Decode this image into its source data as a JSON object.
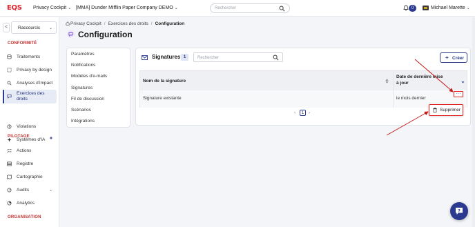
{
  "topbar": {
    "logo_text": "EQS",
    "module_dropdown": "Privacy Cockpit",
    "company_dropdown": "[MMA] Dunder Mifflin Paper Company DEMO",
    "search_placeholder": "Rechercher",
    "notifications_count": "0",
    "user_name": "Michael Marette"
  },
  "sidebar": {
    "collapse_label": "<",
    "shortcuts_label": "Raccourcis",
    "sections": {
      "conformite": "CONFORMITÉ",
      "pilotage": "PILOTAGE",
      "organisation": "ORGANISATION"
    },
    "items": {
      "traitements": "Traitements",
      "privacy_by_design": "Privacy by design",
      "analyses": "Analyses d'impact",
      "exercices": "Exercices des droits",
      "violations": "Violations",
      "systemes_ia": "Systèmes d'IA",
      "actions": "Actions",
      "registre": "Registre",
      "cartographie": "Cartographie",
      "audits": "Audits",
      "analytics": "Analytics"
    }
  },
  "breadcrumb": {
    "home": "Privacy Cockpit",
    "parent": "Exercices des droits",
    "current": "Configuration",
    "separator": "/"
  },
  "page": {
    "title": "Configuration"
  },
  "settings_nav": [
    "Paramètres",
    "Notifications",
    "Modèles d'e-mails",
    "Signatures",
    "Fil de discussion",
    "Scénarios",
    "Intégrations"
  ],
  "panel": {
    "title": "Signatures",
    "count": "1",
    "search_placeholder": "Rechercher",
    "create_label": "Créer",
    "columns": [
      "Nom de la signature",
      "Date de dernière mise à jour"
    ],
    "rows": [
      {
        "name": "Signature existante",
        "updated": "le mois dernier"
      }
    ],
    "row_actions_label": "…",
    "pagination": {
      "current": "1",
      "prev": "‹",
      "next": "›"
    }
  },
  "menu": {
    "delete_label": "Supprimer"
  },
  "colors": {
    "brand": "#2b3a8f",
    "logo": "#e0242c",
    "section": "#c42a2a",
    "annotation": "#e02020"
  }
}
